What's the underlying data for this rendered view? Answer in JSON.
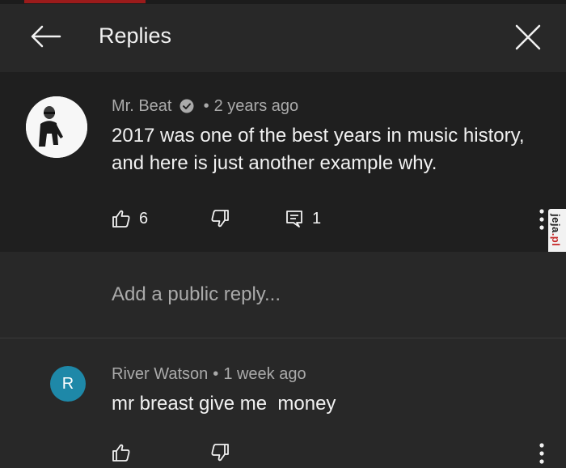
{
  "header": {
    "title": "Replies"
  },
  "main_comment": {
    "author": "Mr. Beat",
    "separator": "•",
    "time": "2 years ago",
    "text": "2017 was one of the best years in music history, and here is just another example why.",
    "likes": "6",
    "replies": "1"
  },
  "reply_input": {
    "placeholder": "Add a public reply..."
  },
  "reply": {
    "avatar_letter": "R",
    "author": "River Watson",
    "separator": "•",
    "time": "1 week ago",
    "text": "mr breast give me  money"
  },
  "watermark": {
    "text": "jeja",
    "suffix": ".pl"
  },
  "colors": {
    "background": "#282828",
    "comment_bg": "#1f1f1f",
    "reply_avatar": "#1e88a8"
  },
  "icons": [
    "back-arrow-icon",
    "close-icon",
    "verified-icon",
    "thumbs-up-icon",
    "thumbs-down-icon",
    "reply-icon",
    "more-vert-icon"
  ]
}
